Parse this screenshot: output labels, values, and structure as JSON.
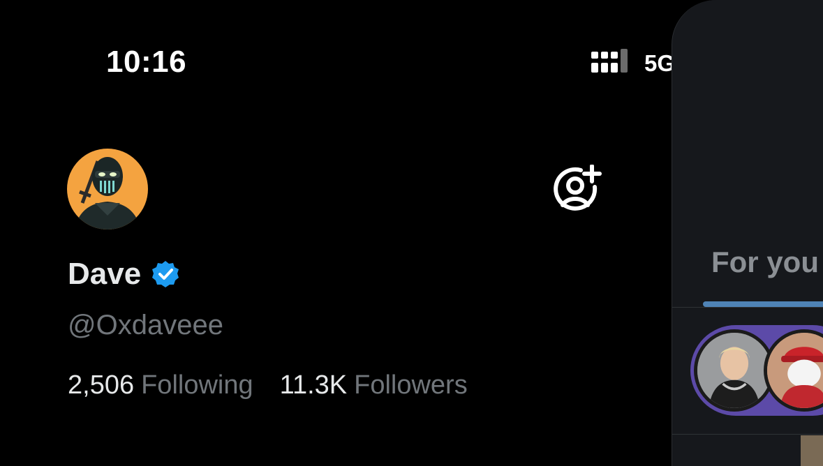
{
  "status_bar": {
    "time": "10:16",
    "network": "5G",
    "signal_icon": "cellular-signal-icon",
    "battery_icon": "battery-low-icon"
  },
  "profile": {
    "display_name": "Dave",
    "handle": "@Oxdaveee",
    "following_count": "2,506",
    "following_label": "Following",
    "followers_count": "11.3K",
    "followers_label": "Followers",
    "avatar_icon": "ninja-avatar",
    "verified_icon": "verified-badge-icon",
    "add_account_icon": "add-account-icon"
  },
  "feed": {
    "tab_label": "For you",
    "accent_color": "#4f83b6",
    "stories": [
      "story-avatar-1",
      "story-avatar-2"
    ]
  },
  "colors": {
    "background": "#000000",
    "secondary_text": "#71767b",
    "verified": "#1d9bf0",
    "avatar_bg": "#f4a340",
    "stories_bg": "#5c4aa8"
  }
}
